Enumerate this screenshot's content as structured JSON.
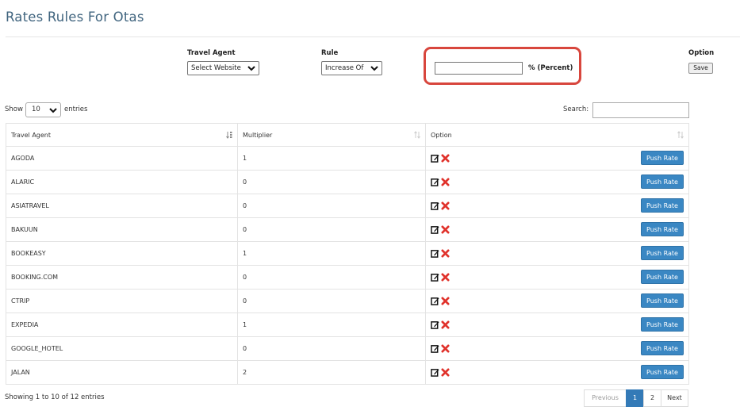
{
  "page": {
    "title": "Rates Rules For Otas"
  },
  "filters": {
    "travel_agent_label": "Travel Agent",
    "travel_agent_value": "Select Website",
    "rule_label": "Rule",
    "rule_value": "Increase Of",
    "percent_value": "",
    "percent_label": "%  (Percent)",
    "option_label": "Option",
    "save_label": "Save"
  },
  "table_controls": {
    "show_label": "Show",
    "entries_value": "10",
    "entries_label": "entries",
    "search_label": "Search:",
    "search_value": ""
  },
  "table": {
    "headers": [
      "Travel Agent",
      "Multiplier",
      "Option"
    ],
    "push_label": "Push Rate",
    "rows": [
      {
        "agent": "AGODA",
        "multiplier": "1"
      },
      {
        "agent": "ALARIC",
        "multiplier": "0"
      },
      {
        "agent": "ASIATRAVEL",
        "multiplier": "0"
      },
      {
        "agent": "BAKUUN",
        "multiplier": "0"
      },
      {
        "agent": "BOOKEASY",
        "multiplier": "1"
      },
      {
        "agent": "BOOKING.COM",
        "multiplier": "0"
      },
      {
        "agent": "CTRIP",
        "multiplier": "0"
      },
      {
        "agent": "EXPEDIA",
        "multiplier": "1"
      },
      {
        "agent": "GOOGLE_HOTEL",
        "multiplier": "0"
      },
      {
        "agent": "JALAN",
        "multiplier": "2"
      }
    ]
  },
  "footer": {
    "info": "Showing 1 to 10 of 12 entries",
    "previous": "Previous",
    "page1": "1",
    "page2": "2",
    "next": "Next"
  },
  "colors": {
    "title": "#41657f",
    "accent": "#337ab7",
    "highlight": "#d8463d",
    "delete": "#e0322b"
  },
  "icons": {
    "edit": "edit-icon",
    "delete": "delete-icon",
    "sort": "sort-icon",
    "dropdown": "chevron-down-icon"
  }
}
